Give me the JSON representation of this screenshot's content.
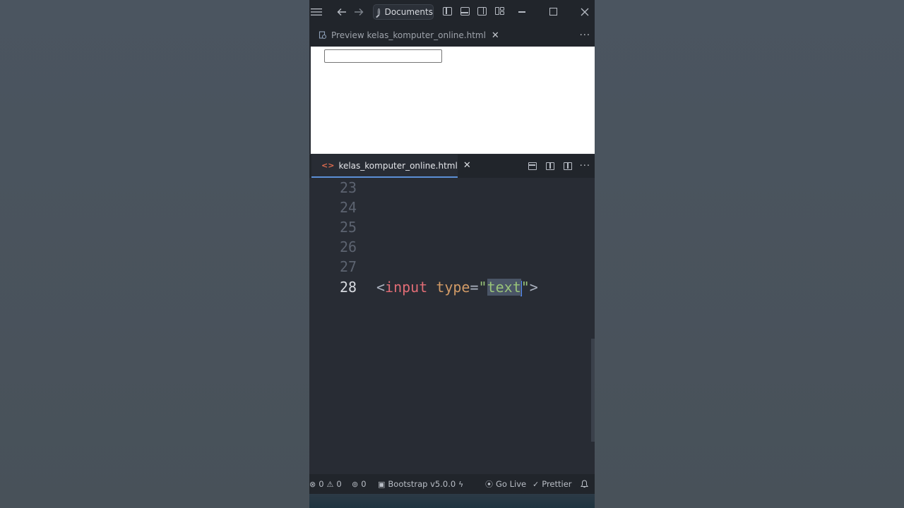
{
  "titlebar": {
    "search_label": "Documents"
  },
  "preview_tab": {
    "label": "Preview kelas_komputer_online.html",
    "close": "✕"
  },
  "editor_tab": {
    "icon": "<>",
    "label": "kelas_komputer_online.html",
    "close": "✕"
  },
  "editor": {
    "lines": [
      {
        "number": "23"
      },
      {
        "number": "24"
      },
      {
        "number": "25"
      },
      {
        "number": "26"
      },
      {
        "number": "27"
      },
      {
        "number": "28"
      }
    ],
    "code_line_28": {
      "open": "<",
      "tag": "input",
      "space": " ",
      "attr": "type",
      "eq": "=",
      "q1": "\"",
      "value": "text",
      "q2": "\"",
      "close": ">"
    }
  },
  "statusbar": {
    "errors": "0",
    "warnings": "0",
    "ports": "0",
    "bootstrap": "Bootstrap v5.0.0",
    "go_live": "Go Live",
    "prettier": "Prettier"
  },
  "icons": {
    "menu": "menu-icon",
    "back": "arrow-left-icon",
    "forward": "arrow-right-icon",
    "search": "search-icon",
    "close": "close-icon",
    "more": "more-icon",
    "bell": "bell-icon"
  }
}
